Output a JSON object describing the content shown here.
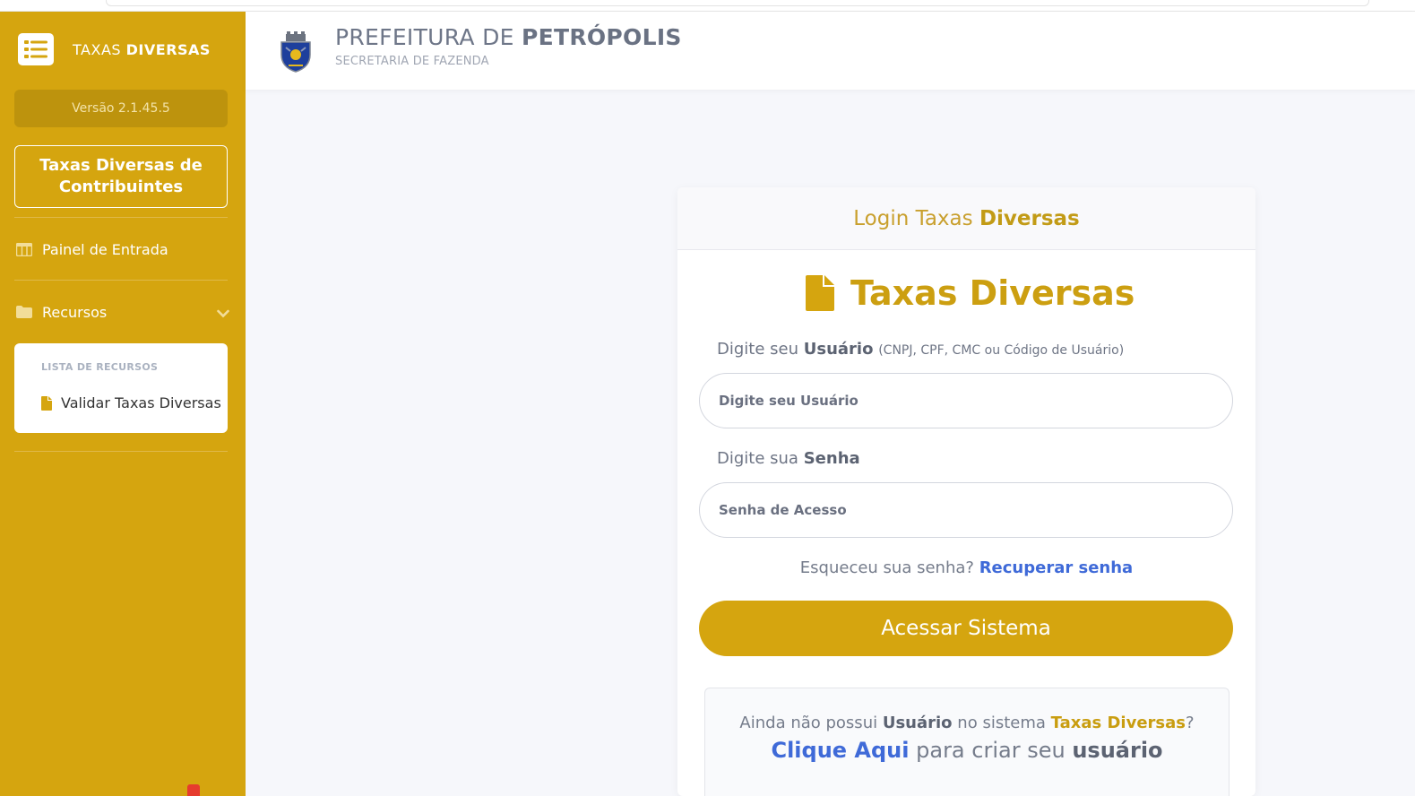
{
  "sidebar": {
    "brand_prefix": "TAXAS",
    "brand_strong": "DIVERSAS",
    "version": "Versão 2.1.45.5",
    "contrib_button": "Taxas Diversas de Contribuintes",
    "nav": {
      "painel": "Painel de Entrada",
      "recursos": "Recursos"
    },
    "submenu": {
      "heading": "LISTA DE RECURSOS",
      "item": "Validar Taxas Diversas"
    },
    "colors": {
      "background": "#d5a50f",
      "version_bg": "#bd930d"
    }
  },
  "header": {
    "title_prefix": "PREFEITURA DE",
    "title_strong": "PETRÓPOLIS",
    "subtitle": "SECRETARIA DE FAZENDA"
  },
  "login": {
    "card_title_prefix": "Login Taxas",
    "card_title_strong": "Diversas",
    "big_title": "Taxas Diversas",
    "user_label_prefix": "Digite seu",
    "user_label_strong": "Usuário",
    "user_label_hint": "(CNPJ, CPF, CMC ou Código de Usuário)",
    "user_placeholder": "Digite seu Usuário",
    "password_label_prefix": "Digite sua",
    "password_label_strong": "Senha",
    "password_placeholder": "Senha de Acesso",
    "forgot_text": "Esqueceu sua senha?",
    "forgot_link": "Recuperar senha",
    "submit": "Acessar Sistema",
    "signup": {
      "l1_a": "Ainda não possui",
      "l1_user": "Usuário",
      "l1_b": "no sistema",
      "l1_system": "Taxas Diversas",
      "l1_q": "?",
      "l2_link": "Clique Aqui",
      "l2_text": "para criar seu",
      "l2_strong": "usuário"
    },
    "colors": {
      "accent": "#d5a50f",
      "link": "#3f6ad8"
    }
  }
}
